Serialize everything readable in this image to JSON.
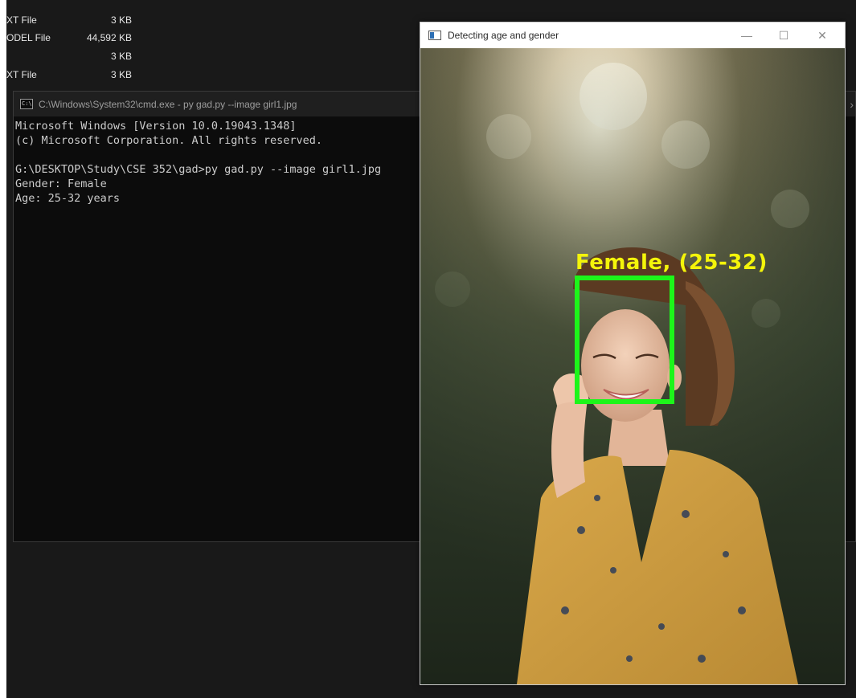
{
  "explorer": {
    "rows": [
      {
        "type": "",
        "size": ""
      },
      {
        "type": "XT File",
        "size": "3 KB"
      },
      {
        "type": "ODEL File",
        "size": "44,592 KB"
      },
      {
        "type": "",
        "size": "3 KB"
      },
      {
        "type": "XT File",
        "size": "3 KB"
      }
    ]
  },
  "cmd": {
    "title": "C:\\Windows\\System32\\cmd.exe - py  gad.py --image girl1.jpg",
    "icon": "cmd-icon",
    "lines": [
      "Microsoft Windows [Version 10.0.19043.1348]",
      "(c) Microsoft Corporation. All rights reserved.",
      "",
      "G:\\DESKTOP\\Study\\CSE 352\\gad>py gad.py --image girl1.jpg",
      "Gender: Female",
      "Age: 25-32 years"
    ]
  },
  "image_window": {
    "title": "Detecting age and gender",
    "minimize_glyph": "—",
    "maximize_glyph": "☐",
    "close_glyph": "✕",
    "detection_label": "Female, (25-32)",
    "box_color": "#1df51a",
    "label_color": "#f4f50a"
  },
  "colors": {
    "backdrop": "#191919",
    "cmd_bg": "#0c0c0c",
    "cmd_text": "#cccccc"
  }
}
